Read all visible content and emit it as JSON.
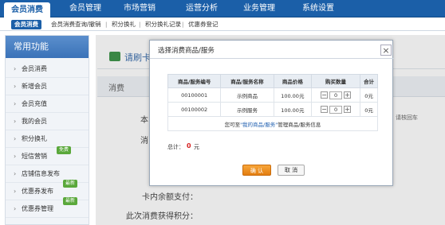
{
  "top_nav": {
    "tabs": [
      {
        "label": "会员消费",
        "active": true
      },
      {
        "label": "会员管理"
      },
      {
        "label": "市场营销"
      },
      {
        "label": "运营分析"
      },
      {
        "label": "业务管理"
      },
      {
        "label": "系统设置"
      }
    ]
  },
  "sub_nav": {
    "items": [
      {
        "label": "会员消费",
        "active": true
      },
      {
        "label": "会员消费查询/撤销"
      },
      {
        "label": "积分换礼"
      },
      {
        "label": "积分换礼记录"
      },
      {
        "label": "优惠券登记"
      }
    ],
    "separator": "|"
  },
  "sidebar": {
    "heading": "常用功能",
    "arrow": "›",
    "items": [
      {
        "label": "会员消费"
      },
      {
        "label": "新增会员"
      },
      {
        "label": "会员充值"
      },
      {
        "label": "我的会员"
      },
      {
        "label": "积分换礼"
      },
      {
        "label": "短信营销",
        "badge": "免费"
      },
      {
        "label": "店铺信息发布"
      },
      {
        "label": "优惠券发布",
        "badge": "最新"
      },
      {
        "label": "优惠券管理",
        "badge": "最新"
      }
    ]
  },
  "background": {
    "card_title": "请刷卡",
    "section_title": "消费",
    "label_a": "本",
    "label_b": "消",
    "label_c": "卡内余额支付：",
    "label_d": "此次消费获得积分：",
    "right_text": "请核回车"
  },
  "modal": {
    "title": "选择消费商品/服务",
    "close_glyph": "×",
    "table": {
      "headers": [
        "商品/服务编号",
        "商品/服务名称",
        "商品价格",
        "购买数量",
        "合计"
      ],
      "rows": [
        {
          "code": "00100001",
          "name": "示例商品",
          "price": "100.00元",
          "qty": "0",
          "total": "0元"
        },
        {
          "code": "00100002",
          "name": "示例服务",
          "price": "100.00元",
          "qty": "0",
          "total": "0元"
        }
      ],
      "minus": "−",
      "plus": "+",
      "tip_prefix": "您可至",
      "tip_link": "\"我的商品/服务\"",
      "tip_suffix": "管理商品/服务信息"
    },
    "total_label": "总计：",
    "total_value": "0",
    "total_unit": "元",
    "ok_label": "确 认",
    "cancel_label": "取 消"
  }
}
